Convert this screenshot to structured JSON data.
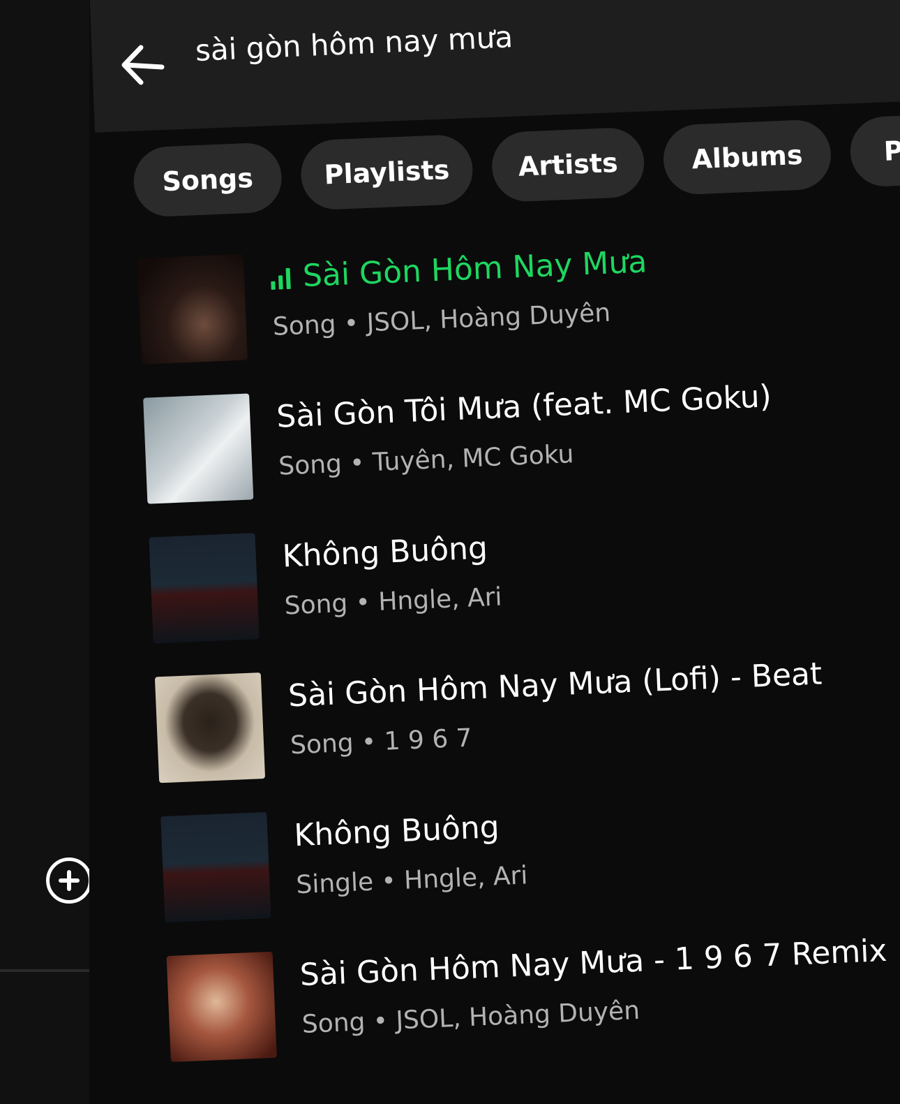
{
  "search": {
    "query": "sài gòn hôm nay mưa"
  },
  "filters": [
    {
      "label": "Songs"
    },
    {
      "label": "Playlists"
    },
    {
      "label": "Artists"
    },
    {
      "label": "Albums"
    },
    {
      "label": "P"
    }
  ],
  "results": [
    {
      "title": "Sài Gòn Hôm Nay Mưa",
      "subtitle": "Song • JSOL, Hoàng Duyên",
      "playing": true
    },
    {
      "title": "Sài Gòn Tôi Mưa (feat. MC Goku)",
      "subtitle": "Song • Tuyên, MC Goku",
      "playing": false
    },
    {
      "title": "Không Buông",
      "subtitle": "Song • Hngle, Ari",
      "playing": false
    },
    {
      "title": "Sài Gòn Hôm Nay Mưa (Lofi) - Beat",
      "subtitle": "Song • 1 9 6 7",
      "playing": false
    },
    {
      "title": "Không Buông",
      "subtitle": "Single • Hngle, Ari",
      "playing": false
    },
    {
      "title": "Sài Gòn Hôm Nay Mưa - 1 9 6 7 Remix",
      "subtitle": "Song • JSOL, Hoàng Duyên",
      "playing": false
    }
  ],
  "colors": {
    "accent": "#1ed760",
    "background": "#0b0b0b",
    "chip": "#2b2b2b",
    "secondary_text": "#b3b3b3"
  },
  "icons": {
    "back": "arrow-left-icon",
    "add": "plus-circle-icon",
    "now_playing": "equalizer-icon"
  }
}
